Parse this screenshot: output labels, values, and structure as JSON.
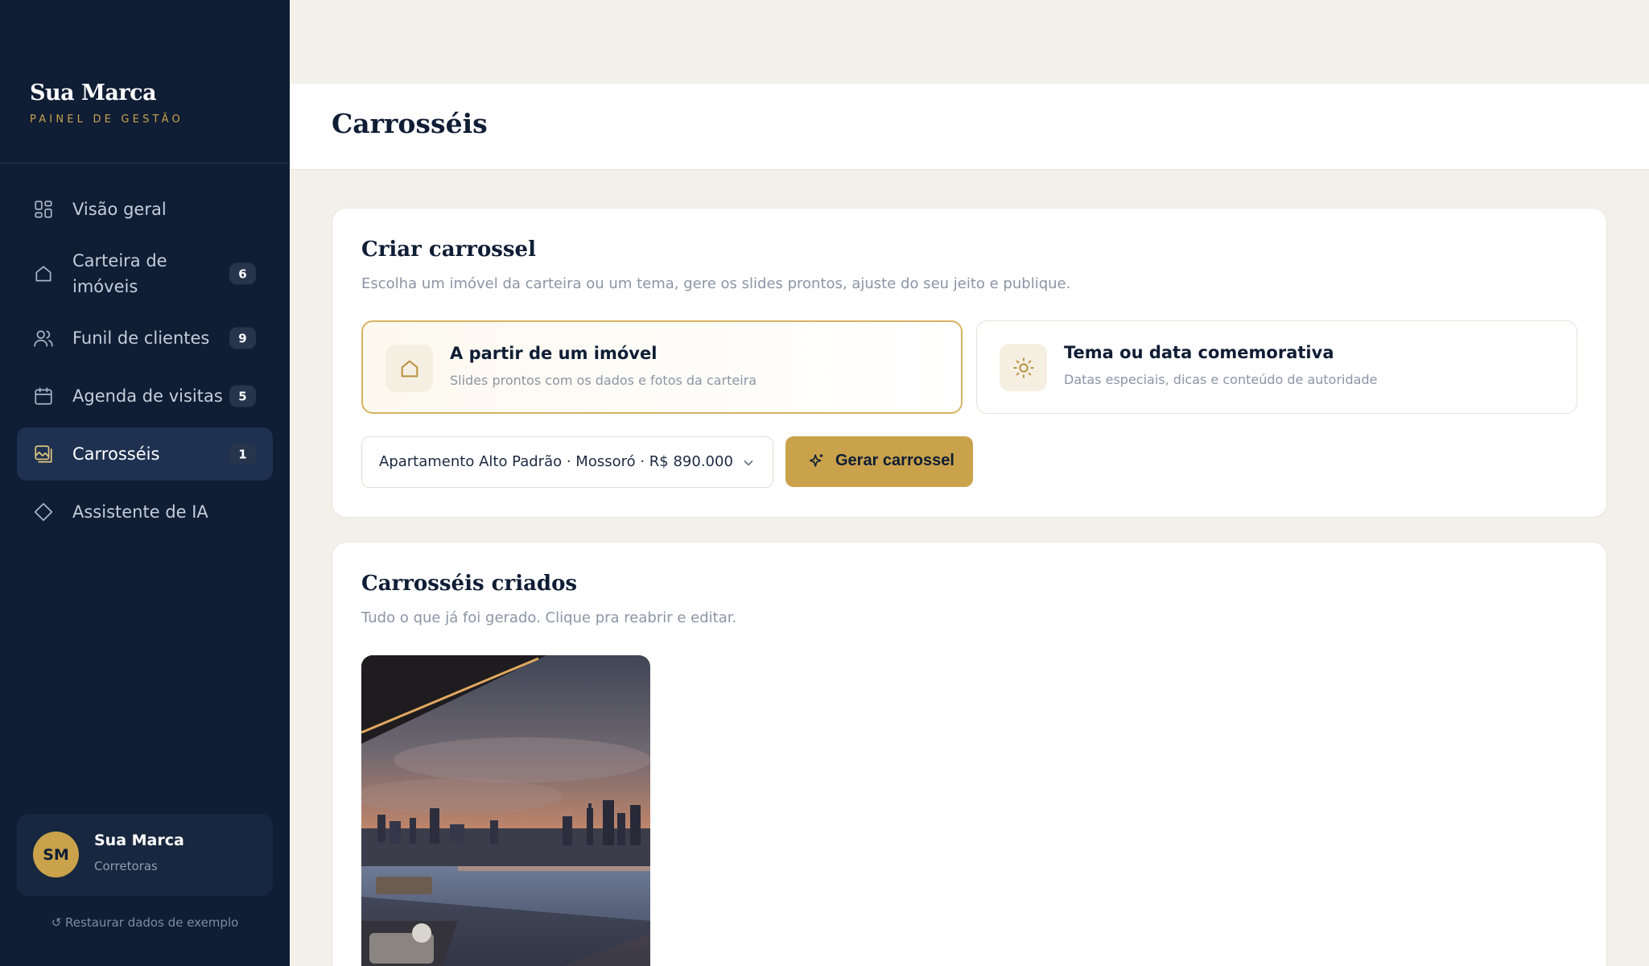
{
  "brand": {
    "name": "Sua Marca",
    "subtitle": "PAINEL DE GESTÃO"
  },
  "nav": {
    "items": [
      {
        "label": "Visão geral",
        "icon": "grid-icon",
        "badge": null
      },
      {
        "label": "Carteira de imóveis",
        "icon": "home-icon",
        "badge": "6"
      },
      {
        "label": "Funil de clientes",
        "icon": "users-icon",
        "badge": "9"
      },
      {
        "label": "Agenda de visitas",
        "icon": "calendar-icon",
        "badge": "5"
      },
      {
        "label": "Carrosséis",
        "icon": "image-stack-icon",
        "badge": "1",
        "active": true
      },
      {
        "label": "Assistente de IA",
        "icon": "diamond-icon",
        "badge": null
      }
    ]
  },
  "user": {
    "initials": "SM",
    "name": "Sua Marca",
    "role": "Corretoras"
  },
  "restore_label": "↺ Restaurar dados de exemplo",
  "page": {
    "title": "Carrosséis"
  },
  "create": {
    "title": "Criar carrossel",
    "subtitle": "Escolha um imóvel da carteira ou um tema, gere os slides prontos, ajuste do seu jeito e publique.",
    "options": [
      {
        "title": "A partir de um imóvel",
        "desc": "Slides prontos com os dados e fotos da carteira",
        "icon": "home-icon",
        "selected": true
      },
      {
        "title": "Tema ou data comemorativa",
        "desc": "Datas especiais, dicas e conteúdo de autoridade",
        "icon": "sun-icon",
        "selected": false
      }
    ],
    "select_value": "Apartamento Alto Padrão · Mossoró · R$ 890.000",
    "generate_label": "Gerar carrossel"
  },
  "created": {
    "title": "Carrosséis criados",
    "subtitle": "Tudo o que já foi gerado. Clique pra reabrir e editar."
  },
  "colors": {
    "sidebar": "#0f1d35",
    "accent": "#c9a24b",
    "background": "#f3f0ea"
  }
}
